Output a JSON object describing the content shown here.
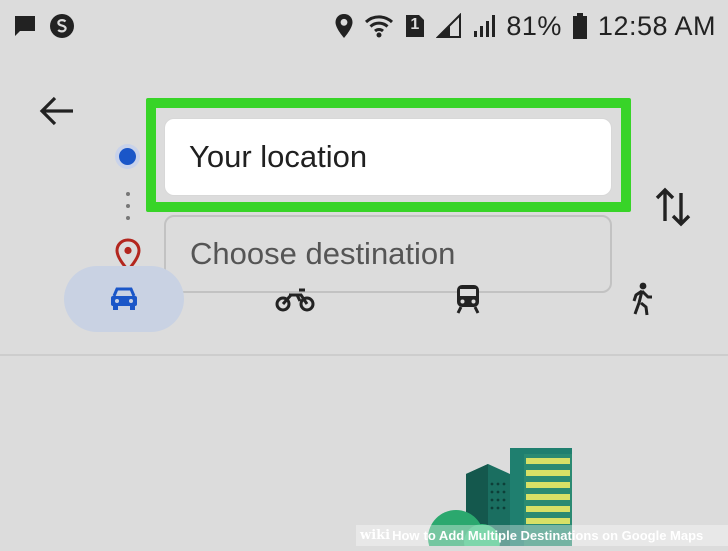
{
  "status_bar": {
    "battery_percent": "81%",
    "time": "12:58 AM",
    "sim_badge": "1",
    "icons": [
      "message-icon",
      "sync-app-icon",
      "location-icon",
      "wifi-icon",
      "sim-icon",
      "signal-icon",
      "battery-icon"
    ]
  },
  "directions": {
    "origin_value": "Your location",
    "destination_placeholder": "Choose destination",
    "origin_dot_color": "#1a56c8",
    "destination_pin_color": "#b3261e",
    "highlight_color": "#38d428"
  },
  "travel_modes": [
    {
      "name": "car",
      "selected": true,
      "icon": "car-icon"
    },
    {
      "name": "motorcycle",
      "selected": false,
      "icon": "motorcycle-icon"
    },
    {
      "name": "transit",
      "selected": false,
      "icon": "train-icon"
    },
    {
      "name": "walking",
      "selected": false,
      "icon": "walking-icon"
    }
  ],
  "watermark": {
    "brand": "wiki",
    "how": "How",
    "text": "to Add Multiple Destinations on Google Maps"
  }
}
